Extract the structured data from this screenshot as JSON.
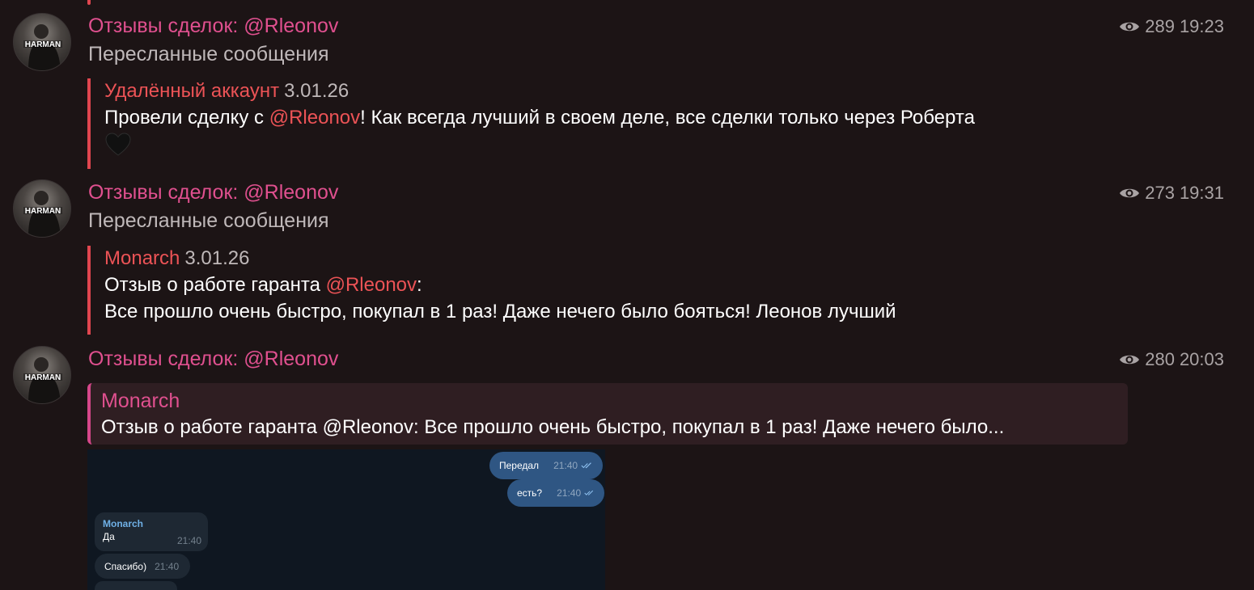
{
  "messages": [
    {
      "channel": "Отзывы сделок: @Rleonov",
      "views": "289",
      "time": "19:23",
      "forwarded_label": "Пересланные сообщения",
      "fwd_author": "Удалённый аккаунт",
      "fwd_date": "3.01.26",
      "text_before": "Провели сделку с ",
      "mention": "@Rleonov",
      "text_after": "! Как всегда лучший в своем деле, все сделки только через Роберта"
    },
    {
      "channel": "Отзывы сделок: @Rleonov",
      "views": "273",
      "time": "19:31",
      "forwarded_label": "Пересланные сообщения",
      "fwd_author": "Monarch",
      "fwd_date": "3.01.26",
      "line1_before": "Отзыв о работе гаранта ",
      "mention": "@Rleonov",
      "line1_after": ":",
      "line2": "Все прошло очень быстро, покупал в 1 раз! Даже нечего было бояться! Леонов лучший"
    },
    {
      "channel": "Отзывы сделок: @Rleonov",
      "views": "280",
      "time": "20:03",
      "reply_author": "Monarch",
      "reply_text": "Отзыв о работе гаранта @Rleonov: Все прошло очень быстро, покупал в 1 раз! Даже нечего было...",
      "screenshot": {
        "out1_text": "Передал",
        "out1_time": "21:40",
        "out2_text": "есть?",
        "out2_time": "21:40",
        "in1_name": "Monarch",
        "in1_text": "Да",
        "in1_time": "21:40",
        "in2_text": "Спасибо)",
        "in2_time": "21:40"
      }
    }
  ],
  "icons": {
    "views": "eye-icon",
    "heart": "black-heart-icon",
    "read": "double-check-icon"
  },
  "colors": {
    "background": "#1c1415",
    "channel": "#e0508f",
    "accent": "#e0464f",
    "mention": "#ec5356"
  }
}
